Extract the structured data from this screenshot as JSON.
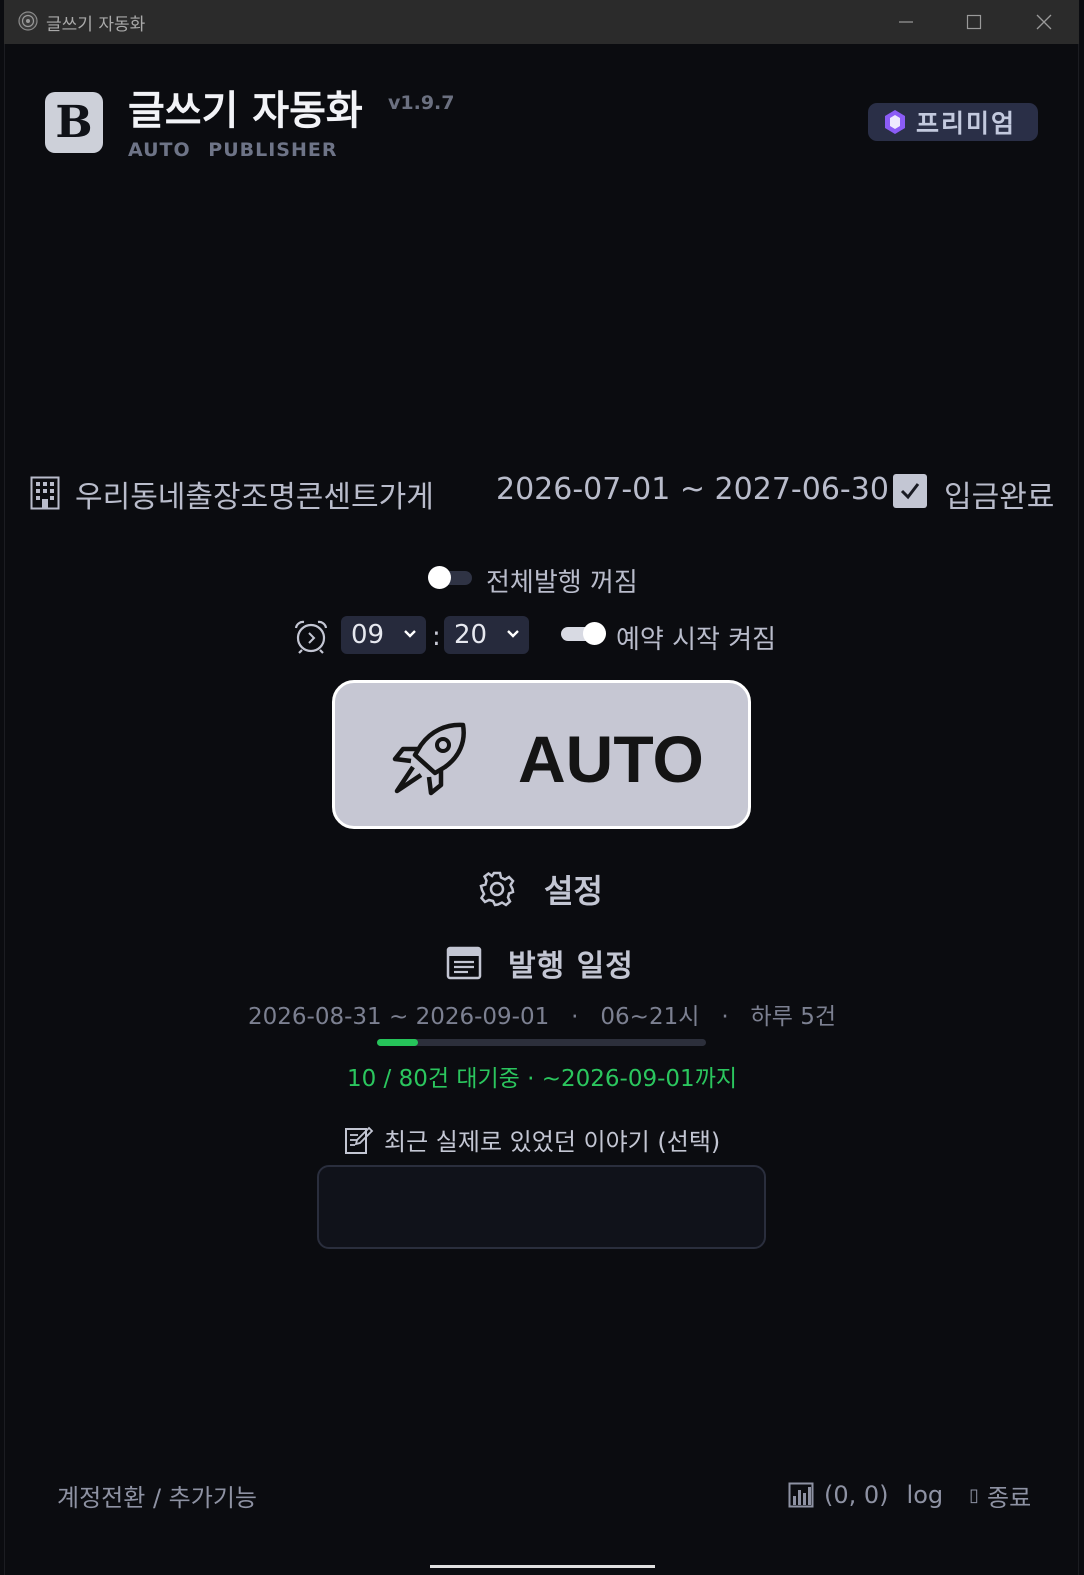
{
  "window": {
    "title": "글쓰기 자동화"
  },
  "header": {
    "logo_letter": "B",
    "title": "글쓰기 자동화",
    "version": "v1.9.7",
    "subtitle": "AUTO   PUBLISHER",
    "badge": "프리미엄"
  },
  "account": {
    "store_name": "우리동네출장조명콘센트가게",
    "period": "2026-07-01 ~ 2027-06-30",
    "paid_label": "입금완료",
    "paid_checked": true
  },
  "publish_all": {
    "label": "전체발행 꺼짐",
    "on": false
  },
  "reservation": {
    "hour": "09",
    "minute": "20",
    "separator": ":",
    "label": "예약 시작 켜짐",
    "on": true
  },
  "auto_button": {
    "label": "AUTO"
  },
  "settings": {
    "label": "설정"
  },
  "schedule": {
    "label": "발행 일정",
    "info": "2026-08-31 ~ 2026-09-01   ·   06~21시   ·   하루 5건",
    "progress_done": 10,
    "progress_total": 80,
    "queue_text": "10 / 80건 대기중 · ~2026-09-01까지"
  },
  "story": {
    "label": "최근 실제로 있었던 이야기 (선택)",
    "value": ""
  },
  "footer": {
    "left_text": "계정전환 / 추가기능",
    "coords": "(0, 0)",
    "log_label": "log",
    "exit_icon_glyph": "▯",
    "exit_label": "종료"
  },
  "colors": {
    "background": "#0b0c10",
    "accent_green": "#26c45a",
    "premium_bg": "#2a2f47",
    "premium_gem": "#8b5cf6",
    "auto_button_bg": "#c6c7d3"
  }
}
